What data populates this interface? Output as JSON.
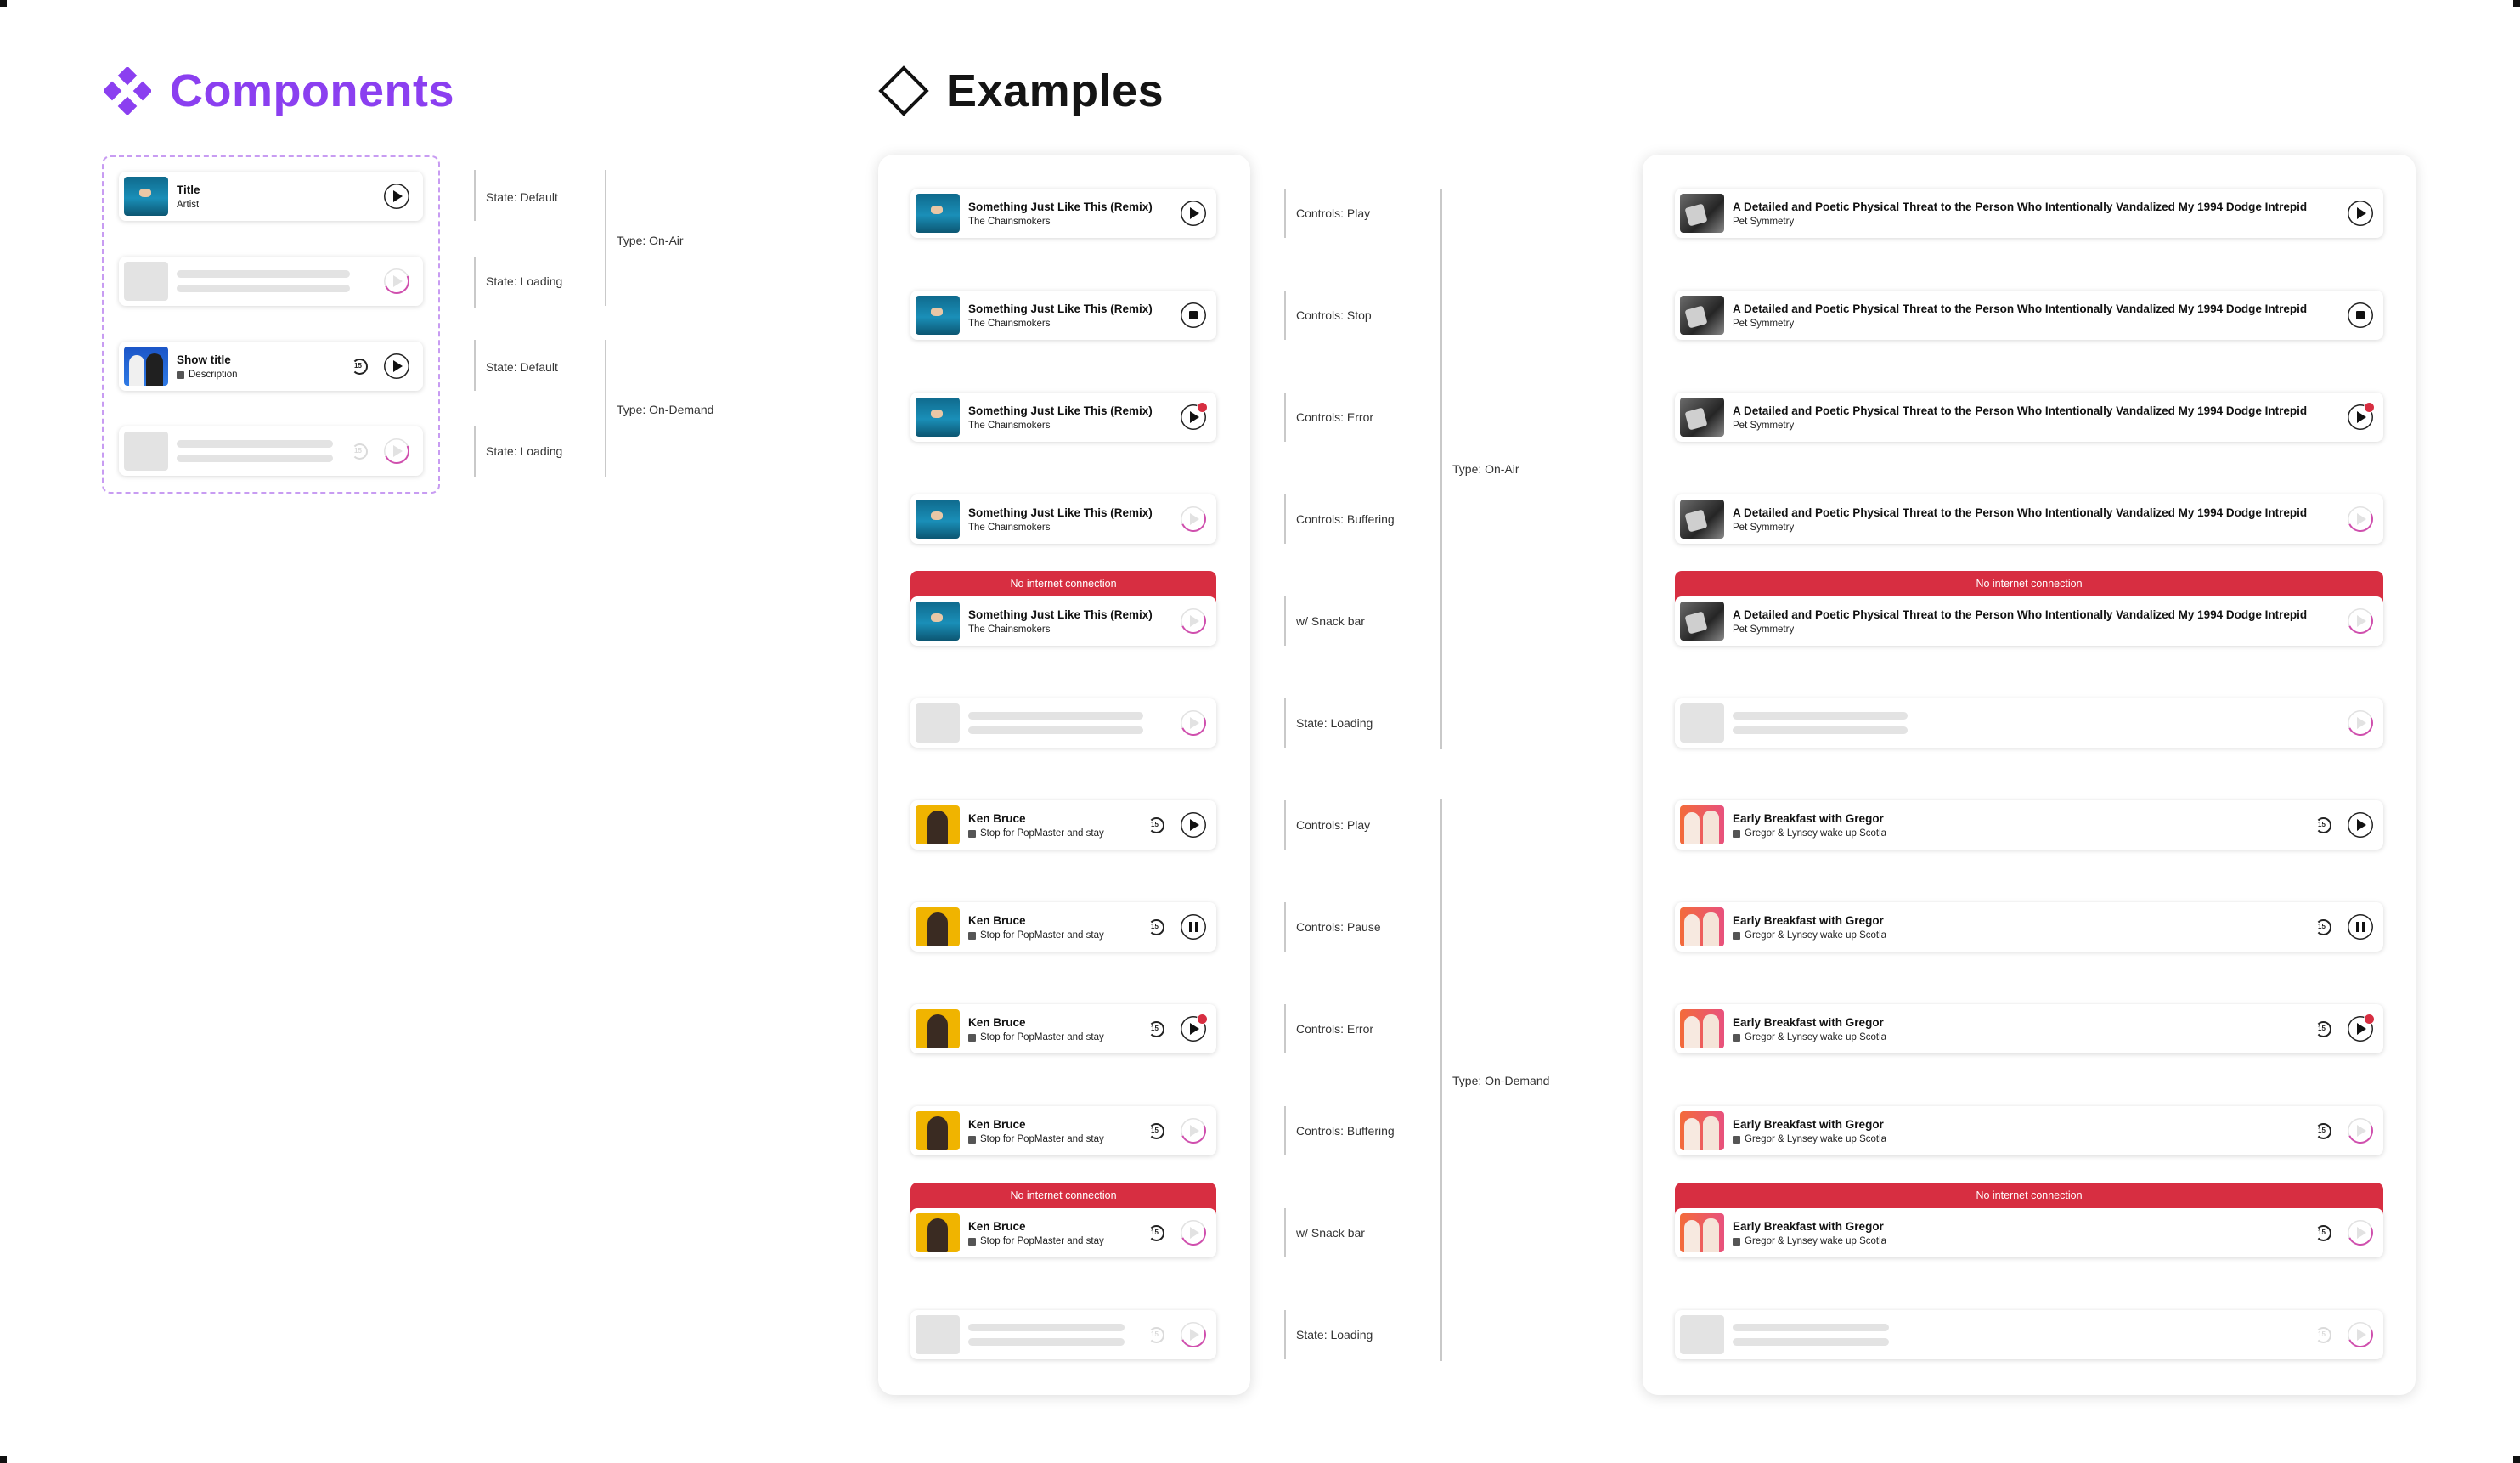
{
  "headings": {
    "components": "Components",
    "examples": "Examples"
  },
  "components": {
    "onair_title": "Title",
    "onair_artist": "Artist",
    "ondemand_title": "Show title",
    "ondemand_desc": "Description"
  },
  "onair_example": {
    "title": "Something Just Like This (Remix)",
    "artist": "The Chainsmokers"
  },
  "onair_example_wide": {
    "title": "A Detailed and Poetic Physical Threat to the Person Who Intentionally Vandalized My 1994 Dodge Intrepid",
    "artist": "Pet Symmetry"
  },
  "ondemand_example": {
    "title": "Ken Bruce",
    "desc": "Stop for PopMaster and stay"
  },
  "ondemand_example_wide": {
    "title": "Early Breakfast with Gregor",
    "desc": "Gregor & Lynsey wake up Scotland"
  },
  "snackbar": "No internet connection",
  "labels": {
    "state_default": "State: Default",
    "state_loading": "State: Loading",
    "type_onair": "Type: On-Air",
    "type_ondemand": "Type: On-Demand",
    "controls_play": "Controls: Play",
    "controls_stop": "Controls: Stop",
    "controls_error": "Controls: Error",
    "controls_buffering": "Controls: Buffering",
    "controls_pause": "Controls: Pause",
    "with_snackbar": "w/ Snack bar"
  },
  "colors": {
    "accent": "#8b3ff0",
    "error": "#d72e41",
    "buffer": "#d04fae"
  }
}
